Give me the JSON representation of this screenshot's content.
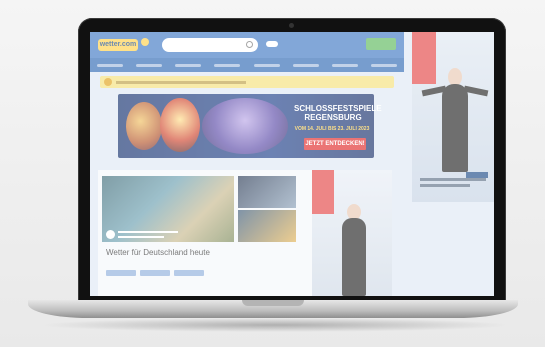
{
  "site": {
    "logo": "wetter.com",
    "search_placeholder": "",
    "nav": [
      "",
      "",
      "",
      "",
      "",
      "",
      "",
      ""
    ],
    "warning": ""
  },
  "advert": {
    "title": "SCHLOSSFESTSPIELE REGENSBURG",
    "dates": "VOM 14. JULI BIS 23. JULI 2023",
    "cta": "JETZT ENTDECKEN!"
  },
  "main": {
    "heading": "Wetter für Deutschland heute"
  },
  "side_ad": {
    "title": ""
  }
}
